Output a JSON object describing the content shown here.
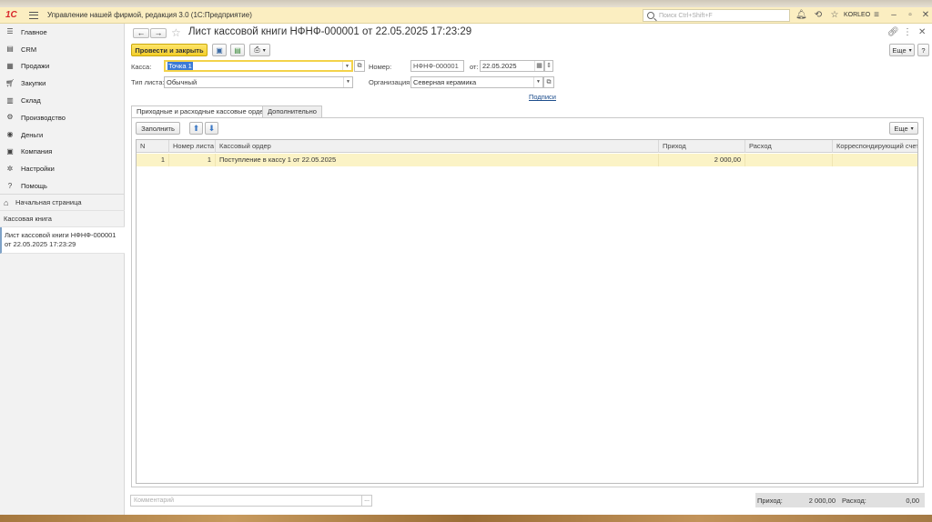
{
  "app": {
    "title": "Управление нашей фирмой, редакция 3.0  (1С:Предприятие)",
    "logo": "1С",
    "search_placeholder": "Поиск Ctrl+Shift+F",
    "user": "KORLEO"
  },
  "sections": [
    {
      "label": "Главное",
      "icon": "menu-icon"
    },
    {
      "label": "CRM",
      "icon": "crm-icon"
    },
    {
      "label": "Продажи",
      "icon": "sales-icon"
    },
    {
      "label": "Закупки",
      "icon": "purchases-icon"
    },
    {
      "label": "Склад",
      "icon": "warehouse-icon"
    },
    {
      "label": "Производство",
      "icon": "production-icon"
    },
    {
      "label": "Деньги",
      "icon": "money-icon"
    },
    {
      "label": "Компания",
      "icon": "company-icon"
    },
    {
      "label": "Настройки",
      "icon": "gear-icon"
    },
    {
      "label": "Помощь",
      "icon": "help-icon"
    }
  ],
  "open_windows": {
    "home": "Начальная страница",
    "cash_book": "Кассовая книга",
    "current": "Лист кассовой книги НФНФ-000001 от 22.05.2025 17:23:29"
  },
  "form": {
    "title": "Лист кассовой книги НФНФ-000001 от 22.05.2025 17:23:29",
    "post_close": "Провести и закрыть",
    "more": "Еще",
    "help": "?",
    "fields": {
      "kassa_label": "Касса:",
      "kassa_value": "Точка 1",
      "number_label": "Номер:",
      "number_value": "НФНФ-000001",
      "date_label": "от:",
      "date_value": "22.05.2025",
      "sheet_type_label": "Тип листа:",
      "sheet_type_value": "Обычный",
      "org_label": "Организация:",
      "org_value": "Северная керамика",
      "signatures_link": "Подписи"
    },
    "tabs": [
      {
        "label": "Приходные и расходные кассовые ордера",
        "active": true
      },
      {
        "label": "Дополнительно",
        "active": false
      }
    ],
    "fill_button": "Заполнить",
    "table_more": "Еще",
    "columns": [
      "N",
      "Номер листа",
      "Кассовый ордер",
      "Приход",
      "Расход",
      "Корреспондирующий счет"
    ],
    "rows": [
      {
        "n": "1",
        "sheet_no": "1",
        "order": "Поступление в кассу 1 от 22.05.2025",
        "income": "2 000,00",
        "expense": "",
        "account": ""
      }
    ],
    "comment_placeholder": "Комментарий",
    "totals": {
      "income_label": "Приход:",
      "income_value": "2 000,00",
      "expense_label": "Расход:",
      "expense_value": "0,00"
    }
  }
}
